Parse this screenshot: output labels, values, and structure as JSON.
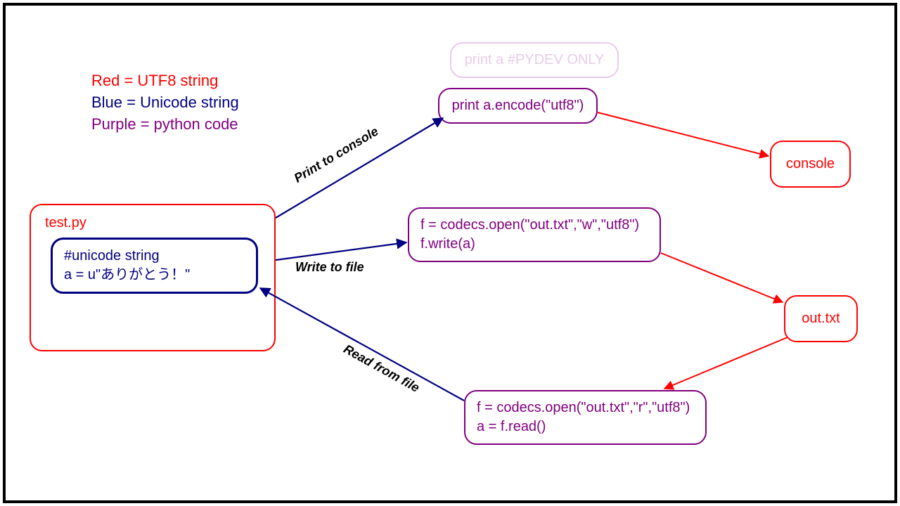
{
  "legend": {
    "utf8": "Red = UTF8 string",
    "unicode": "Blue = Unicode string",
    "python": "Purple = python code"
  },
  "source_file": {
    "name": "test.py",
    "code_comment": "#unicode string",
    "code_line": "a = u\"ありがとう！\""
  },
  "print_pydev": "print a #PYDEV ONLY",
  "print_encode": "print a.encode(\"utf8\")",
  "write_file": {
    "line1": "f = codecs.open(\"out.txt\",\"w\",\"utf8\")",
    "line2": "f.write(a)"
  },
  "read_file": {
    "line1": "f = codecs.open(\"out.txt\",\"r\",\"utf8\")",
    "line2": "a = f.read()"
  },
  "console_label": "console",
  "outtxt_label": "out.txt",
  "edge_labels": {
    "print": "Print to console",
    "write": "Write to file",
    "read": "Read from file"
  },
  "colors": {
    "utf8": "#ff0000",
    "unicode": "#000080",
    "python": "#800080"
  }
}
